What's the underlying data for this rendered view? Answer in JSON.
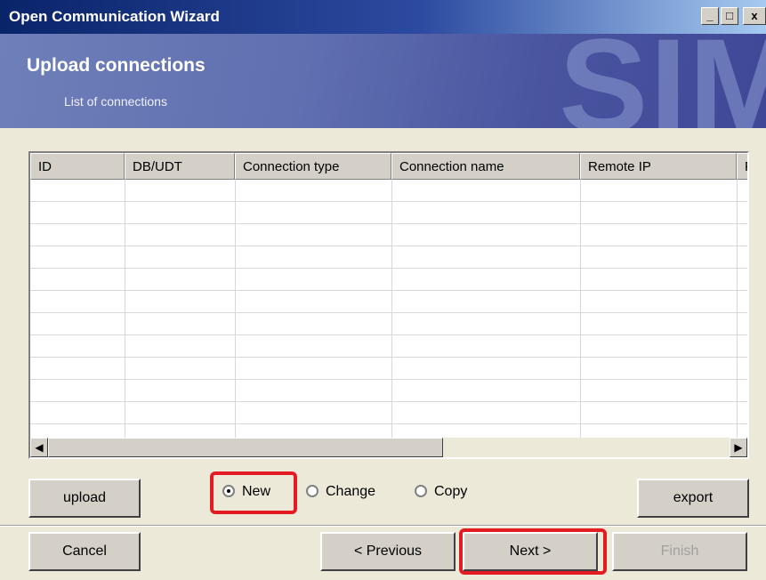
{
  "window": {
    "title": "Open Communication Wizard",
    "controls": [
      "minimize-icon",
      "maximize-icon",
      "close-icon"
    ]
  },
  "banner": {
    "heading": "Upload connections",
    "subheading": "List of connections",
    "watermark": "SIM"
  },
  "table": {
    "columns": [
      "ID",
      "DB/UDT",
      "Connection type",
      "Connection name",
      "Remote IP",
      "F"
    ],
    "rows": []
  },
  "options": {
    "upload_label": "upload",
    "export_label": "export",
    "radios": [
      {
        "label": "New",
        "selected": true
      },
      {
        "label": "Change",
        "selected": false
      },
      {
        "label": "Copy",
        "selected": false
      }
    ]
  },
  "footer": {
    "cancel_label": "Cancel",
    "previous_label": "< Previous",
    "next_label": "Next >",
    "finish_label": "Finish"
  },
  "colors": {
    "highlight": "#e31b23",
    "title_bar": "#0a246a",
    "banner": "#5f6fb0"
  }
}
